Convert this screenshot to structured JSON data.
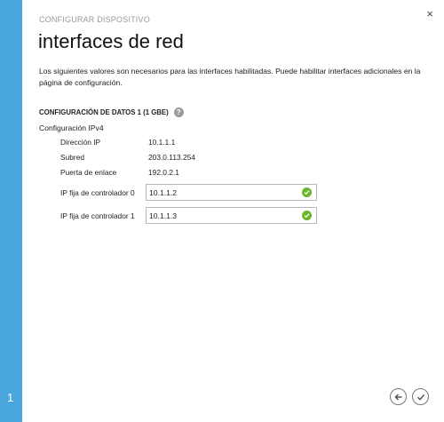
{
  "wizard": {
    "kicker": "CONFIGURAR DISPOSITIVO",
    "title": "interfaces de red",
    "step": "1",
    "description": "Los siguientes valores son necesarios para las interfaces habilitadas. Puede habilitar interfaces adicionales en la página de configuración."
  },
  "section": {
    "heading": "CONFIGURACIÓN DE DATOS 1 (1 GBE)",
    "help_icon": "?",
    "subheading": "Configuración IPv4",
    "rows": [
      {
        "label": "Dirección IP",
        "value": "10.1.1.1"
      },
      {
        "label": "Subred",
        "value": "203.0.113.254"
      },
      {
        "label": "Puerta de enlace",
        "value": "192.0.2.1"
      }
    ],
    "fields": [
      {
        "label": "IP fija de controlador 0",
        "value": "10.1.1.2",
        "valid": true
      },
      {
        "label": "IP fija de controlador 1",
        "value": "10.1.1.3",
        "valid": true
      }
    ]
  },
  "icons": {
    "close": "×",
    "check": "check-icon",
    "back": "arrow-left-icon",
    "done": "checkmark-icon"
  },
  "colors": {
    "accent": "#4aa7de",
    "valid": "#6ab62c"
  }
}
